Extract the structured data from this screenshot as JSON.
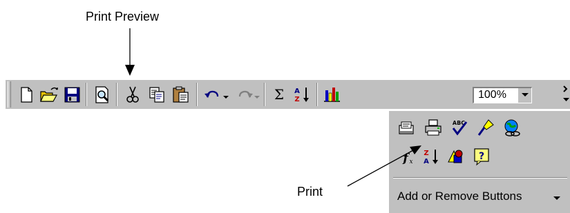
{
  "callouts": {
    "print_preview": "Print Preview",
    "print": "Print"
  },
  "toolbar": {
    "zoom_value": "100%",
    "buttons": [
      "new-icon",
      "open-icon",
      "save-icon",
      "print-preview-icon",
      "cut-icon",
      "copy-icon",
      "paste-icon",
      "undo-icon",
      "redo-icon",
      "autosum-icon",
      "sort-ascending-icon",
      "chart-wizard-icon",
      "zoom-dropdown",
      "more-buttons-icon"
    ]
  },
  "overflow_menu": {
    "icons": [
      "email-icon",
      "print-icon",
      "spelling-icon",
      "format-painter-icon",
      "insert-hyperlink-icon",
      "paste-function-icon",
      "sort-descending-icon",
      "drawing-icon",
      "office-assistant-icon"
    ],
    "add_remove_label": "Add or Remove Buttons"
  },
  "colors": {
    "toolbar_bg": "#c0c0c0",
    "highlight": "#ffffff",
    "shadow": "#808080",
    "page_bg": "#ffffff"
  }
}
